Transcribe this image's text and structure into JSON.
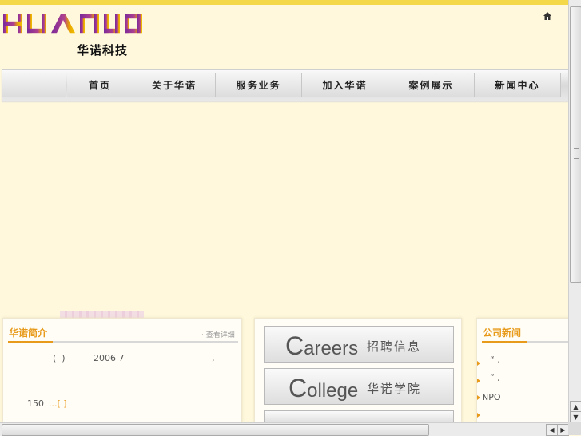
{
  "brand": {
    "logo_text": "HUANUO",
    "logo_cn": "华诺科技"
  },
  "nav": {
    "items": [
      "首页",
      "关于华诺",
      "服务业务",
      "加入华诺",
      "案例展示",
      "新闻中心"
    ]
  },
  "about": {
    "title": "华诺简介",
    "more": "· 查看详细",
    "line1_a": "(  )",
    "line1_b": "2006 7",
    "line1_c": ",",
    "line2_a": "150",
    "line2_more": "...[ ]"
  },
  "banners": [
    {
      "en_initial": "C",
      "en_rest": "areers",
      "cn": "招聘信息"
    },
    {
      "en_initial": "C",
      "en_rest": "ollege",
      "cn": "华诺学院"
    }
  ],
  "news": {
    "title": "公司新闻",
    "items": [
      "“    ,",
      "“    ,",
      "NPO",
      ""
    ]
  },
  "colors": {
    "accent": "#e89a1a",
    "top_bar": "#f5d84a",
    "logo_purple": "#6a2a8c",
    "page_bg": "#fff8dc"
  }
}
